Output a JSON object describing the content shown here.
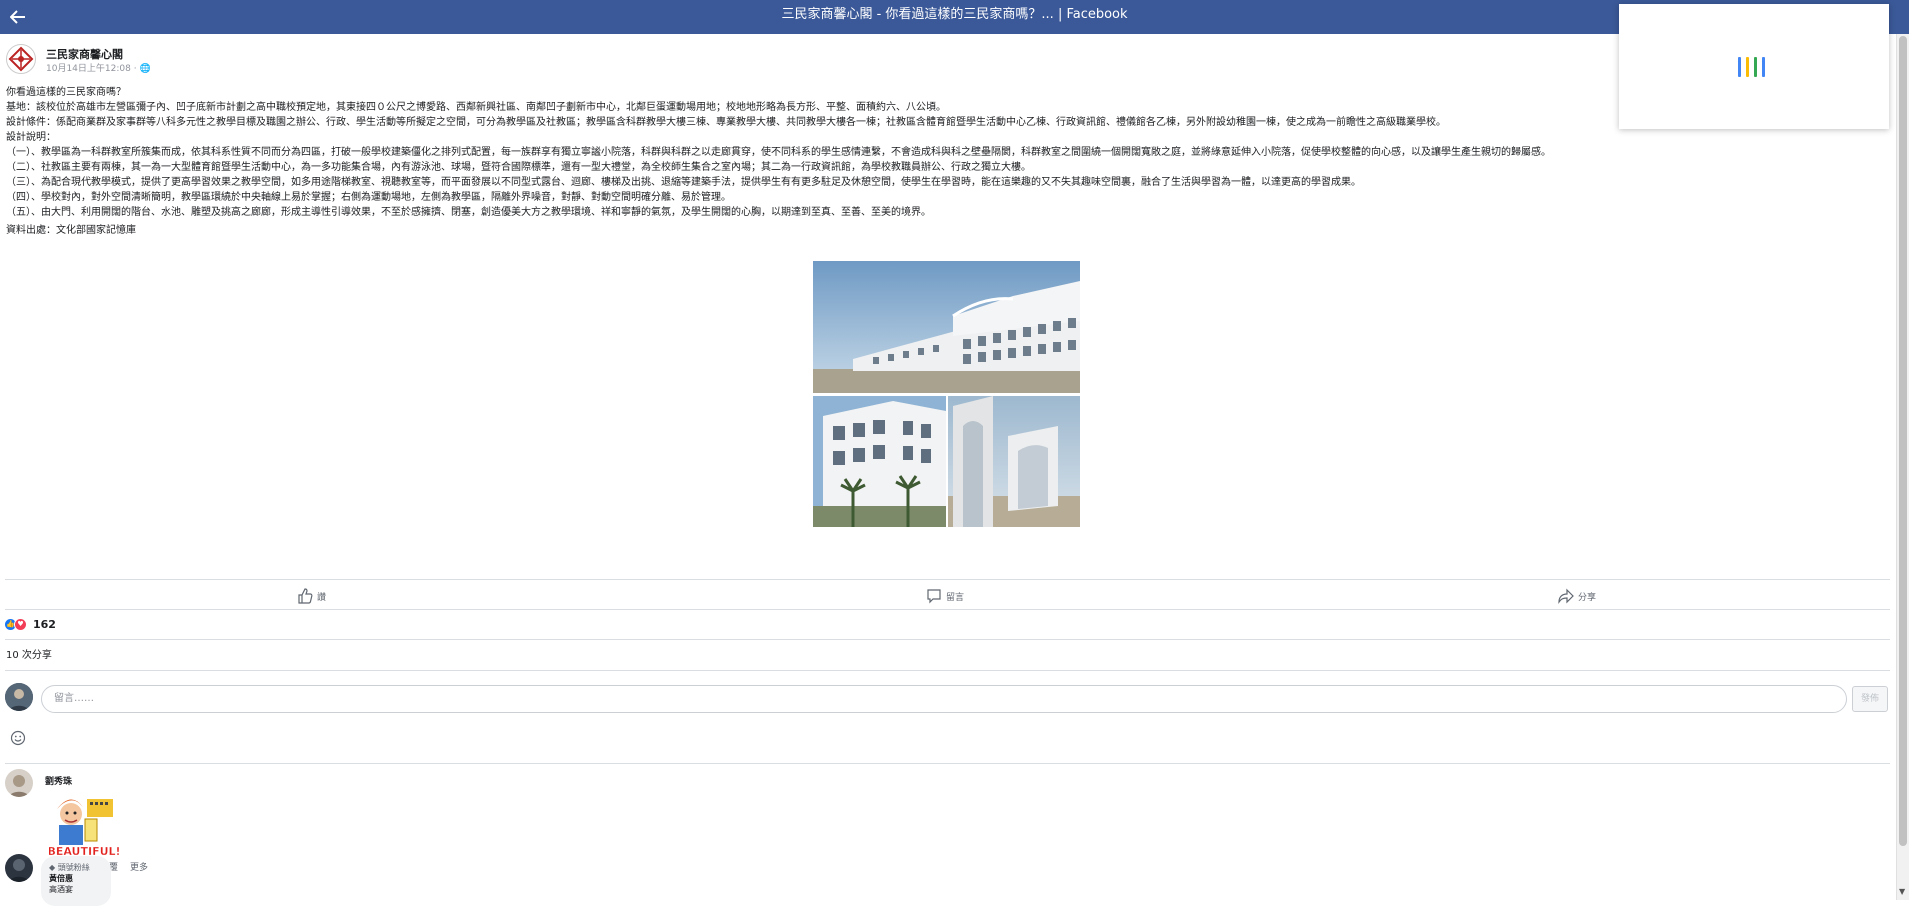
{
  "window": {
    "title": "三民家商馨心閣 - 你看過這樣的三民家商嗎？... | Facebook",
    "back_icon": "arrow-left-icon"
  },
  "loader": {
    "colors": [
      "#4285f4",
      "#fbbc05",
      "#34a853",
      "#4285f4"
    ]
  },
  "post": {
    "page_name": "三民家商馨心閣",
    "date": "10月14日上午12:08 · ",
    "lines": [
      "你看過這樣的三民家商嗎？",
      "基地：該校位於高雄市左營區彌子內、凹子底新市計劃之高中職校預定地，其東接四０公尺之博愛路、西鄰新興社區、南鄰凹子劃新市中心，北鄰巨蛋運動場用地；校地地形略為長方形、平整、面積約六、八公頃。",
      "設計條件：係配商業群及家事群等八科多元性之教學目標及職園之辦公、行政、學生活動等所擬定之空間，可分為教學區及社教區；教學區含科群教學大樓三棟、專業教學大樓、共同教學大樓各一棟；社教區含體育館暨學生活動中心乙棟、行政資訊館、禮儀館各乙棟，另外附設幼稚園一棟，使之成為一前瞻性之高級職業學校。",
      "設計說明：",
      "（一）、教學區為一科群教室所簇集而成，依其科系性質不同而分為四區，打破一般學校建築僵化之排列式配置，每一族群享有獨立寧謐小院落，科群與科群之以走廊貫穿，使不同科系的學生感情連繫，不會造成科與科之壁壘隔閡，科群教室之間圍繞一個開闊寬敞之庭，並將綠意延伸入小院落，促使學校整體的向心感，以及讓學生產生親切的歸屬感。",
      "（二）、社教區主要有兩棟，其一為一大型體育館暨學生活動中心，為一多功能集合場，內有游泳池、球場，暨符合國際標準，還有一型大禮堂，為全校師生集合之室內場；其二為一行政資訊館，為學校教職員辦公、行政之獨立大樓。",
      "（三）、為配合現代教學模式，提供了更高學習效果之教學空間，如多用途階梯教室、視聽教室等，而平面發展以不同型式露台、迴廊、樓梯及出挑、退縮等建築手法，提供學生有有更多駐足及休憩空間，使學生在學習時，能在這樂趣的又不失其趣味空間裏，融合了生活與學習為一體，以達更高的學習成果。",
      "（四）、學校對內，對外空間清晰簡明，教學區環繞於中央軸線上易於掌握；右側為運動場地，左側為教學區，隔離外界噪音，對靜、對動空間明確分離、易於管理。",
      "（五）、由大門、利用開闊的階台、水池、雕塑及挑高之廊廊，形成主導性引導效果，不至於感擁擠、閉塞，創造優美大方之教學環境、祥和寧靜的氣氛，及學生開闊的心胸，以期達到至真、至善、至美的境界。",
      "資料出處：文化部國家記憶庫"
    ]
  },
  "actions": {
    "like": "讚",
    "comment": "留言",
    "share": "分享"
  },
  "stats": {
    "reaction_count": "162",
    "shares_text": "10 次分享"
  },
  "composer": {
    "placeholder": "留言……",
    "post_button": "發佈"
  },
  "comments": [
    {
      "name": "劉秀珠",
      "sticker_text": "BEAUTIFUL!",
      "actions": [
        "讚"
      ]
    },
    {
      "badge": "頭號粉絲",
      "name": "黃倍惠",
      "text": "高酒宴"
    }
  ],
  "comment_actions": [
    "週日",
    "讚",
    "回覆",
    "更多"
  ]
}
